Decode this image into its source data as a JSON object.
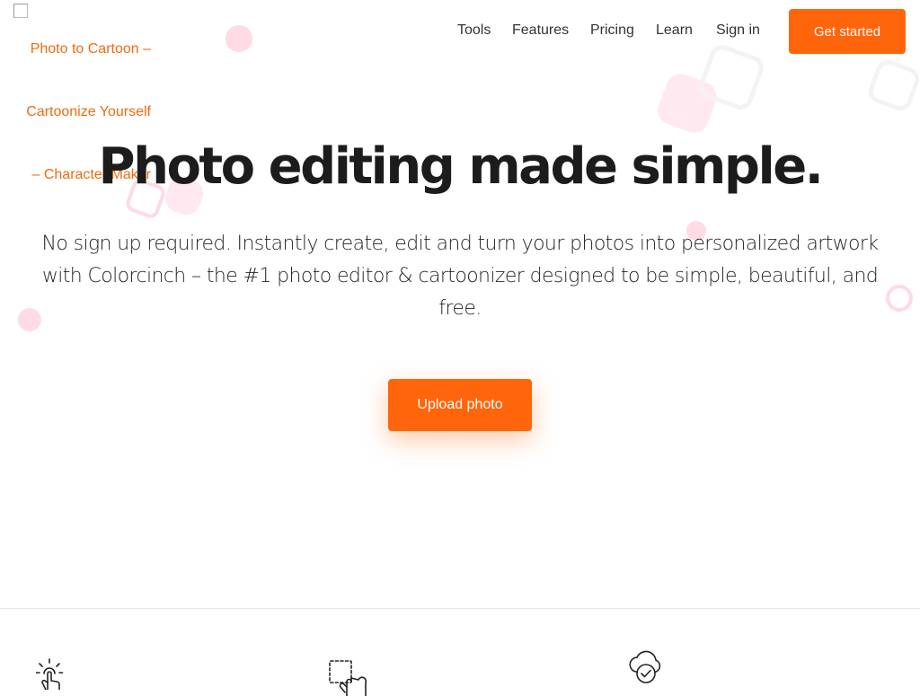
{
  "logo": {
    "alt_lines": [
      "Photo to Cartoon –",
      "Cartoonize Yourself",
      "– Character Maker"
    ]
  },
  "nav": {
    "links": [
      "Tools",
      "Features",
      "Pricing",
      "Learn",
      "Sign in"
    ],
    "cta_label": "Get started"
  },
  "hero": {
    "title": "Photo editing made simple.",
    "subtitle": "No sign up required. Instantly create, edit and turn your photos into personalized artwork with Colorcinch – the #1 photo editor & cartoonizer designed to be simple, beautiful, and free.",
    "upload_label": "Upload photo"
  },
  "features": {
    "icons": [
      "touch-sparkle-icon",
      "select-drag-icon",
      "cloud-check-icon"
    ]
  },
  "colors": {
    "accent": "#ff650a",
    "link": "#ee6b0f",
    "text": "#1c1c1c"
  }
}
